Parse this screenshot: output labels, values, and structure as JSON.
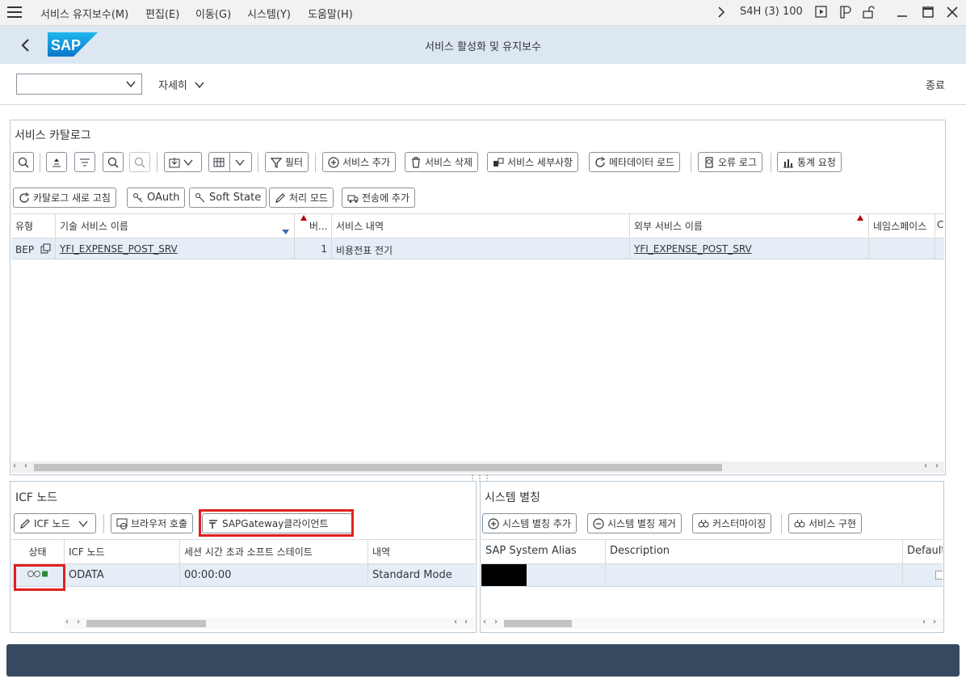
{
  "menubar": {
    "items": [
      "서비스 유지보수(M)",
      "편집(E)",
      "이동(G)",
      "시스템(Y)",
      "도움말(H)"
    ],
    "system_info": "S4H (3) 100"
  },
  "header": {
    "title": "서비스 활성화 및 유지보수",
    "logo_text": "SAP"
  },
  "toolbar": {
    "command_value": "",
    "more_label": "자세히",
    "exit_label": "종료"
  },
  "catalog": {
    "title": "서비스 카탈로그",
    "buttons_row1": {
      "filter": "필터",
      "add_service": "서비스 추가",
      "delete_service": "서비스 삭제",
      "service_details": "서비스 세부사항",
      "load_metadata": "메타데이터 로드",
      "error_log": "오류 로그",
      "stats_request": "통계 요청"
    },
    "buttons_row2": {
      "refresh_catalog": "카탈로그 새로 고침",
      "oauth": "OAuth",
      "soft_state": "Soft State",
      "processing_mode": "처리 모드",
      "add_transport": "전송에 추가"
    },
    "columns": [
      "유형",
      "기술 서비스 이름",
      "버...",
      "서비스 내역",
      "외부 서비스 이름",
      "네임스페이스",
      "C"
    ],
    "rows": [
      {
        "type": "BEP",
        "tech_name": "YFI_EXPENSE_POST_SRV",
        "version": "1",
        "description": "비용전표 전기",
        "external_name": "YFI_EXPENSE_POST_SRV",
        "namespace": ""
      }
    ]
  },
  "icf": {
    "title": "ICF 노드",
    "buttons": {
      "icf_node": "ICF 노드",
      "browser_call": "브라우저 호출",
      "gateway_client": "SAPGateway클라이언트"
    },
    "columns": [
      "상태",
      "ICF 노드",
      "세션 시간 초과 소프트 스테이트",
      "내역"
    ],
    "rows": [
      {
        "status": "○○■",
        "node": "ODATA",
        "timeout": "00:00:00",
        "description": "Standard Mode"
      }
    ]
  },
  "alias": {
    "title": "시스템 별칭",
    "buttons": {
      "add_alias": "시스템 별칭 추가",
      "remove_alias": "시스템 별칭 제거",
      "customizing": "커스터마이징",
      "service_impl": "서비스 구현"
    },
    "columns": [
      "SAP System Alias",
      "Description",
      "Default"
    ]
  },
  "colors": {
    "shell": "#dce7f1",
    "accent": "#0a6ed1",
    "footer": "#354a5f",
    "highlight": "#e02020"
  }
}
